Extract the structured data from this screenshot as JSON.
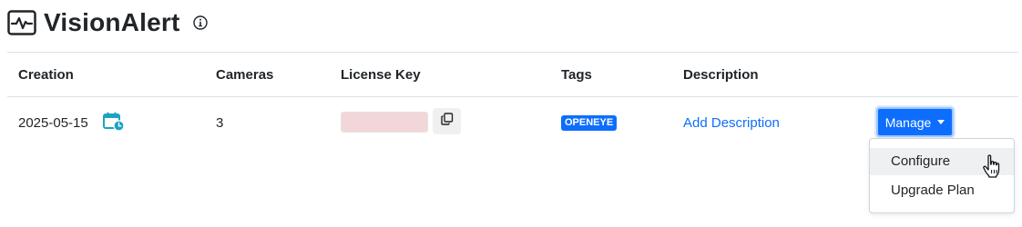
{
  "app": {
    "title": "VisionAlert",
    "icon": "activity-monitor-icon",
    "info_icon": "info-icon"
  },
  "table": {
    "headers": {
      "creation": "Creation",
      "cameras": "Cameras",
      "license_key": "License Key",
      "tags": "Tags",
      "description": "Description"
    },
    "rows": [
      {
        "creation": "2025-05-15",
        "cameras": "3",
        "license_key": "",
        "tag": "OPENEYE",
        "description_link": "Add Description",
        "manage_label": "Manage"
      }
    ]
  },
  "menu": {
    "items": [
      "Configure",
      "Upgrade Plan"
    ],
    "hovered_index": 0
  },
  "colors": {
    "accent": "#0d6efd",
    "calendar": "#1aa3c3",
    "key_mask": "#f3d6d8"
  }
}
